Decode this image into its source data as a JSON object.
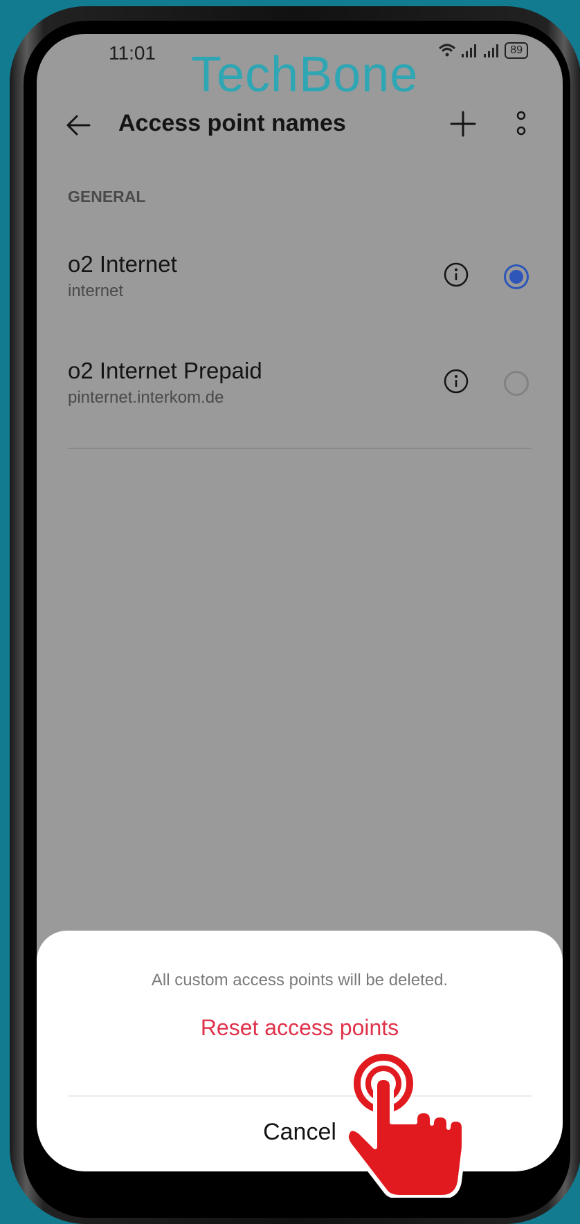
{
  "status_bar": {
    "time": "11:01",
    "battery": "89"
  },
  "watermark": "TechBone",
  "header": {
    "title": "Access point names"
  },
  "section_label": "GENERAL",
  "apn_list": [
    {
      "name": "o2 Internet",
      "apn": "internet",
      "selected": true
    },
    {
      "name": "o2 Internet Prepaid",
      "apn": "pinternet.interkom.de",
      "selected": false
    }
  ],
  "sheet": {
    "message": "All custom access points will be deleted.",
    "reset_label": "Reset access points",
    "cancel_label": "Cancel"
  },
  "colors": {
    "accent_blue": "#2d56b8",
    "danger_red": "#e0314a",
    "background_teal": "#127b8f"
  }
}
